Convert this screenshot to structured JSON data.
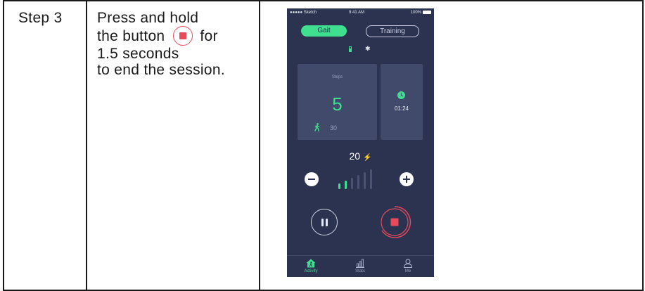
{
  "step": {
    "label": "Step 3",
    "instruction": {
      "line1": "Press and hold",
      "line2_before": "the button",
      "line2_after": "for",
      "line3": "1.5 seconds",
      "line4": "to end the session."
    },
    "inline_icon": "stop-button-icon"
  },
  "phone": {
    "status_bar": {
      "carrier": "●●●●● Sketch",
      "time": "9:41 AM",
      "battery": "100%"
    },
    "tabs": {
      "gait": "Gait",
      "training": "Training",
      "active": "Gait"
    },
    "steps_card": {
      "title": "Steps",
      "value": "5",
      "sub_value": "30",
      "icon": "walking-icon"
    },
    "timer_card": {
      "time": "01:24",
      "icon": "clock-icon"
    },
    "level": {
      "value": "20",
      "icon": "lightning-icon"
    },
    "intensity": {
      "active_bars": 2,
      "total_bars": 6
    },
    "controls": {
      "minus_icon": "minus-icon",
      "plus_icon": "plus-icon",
      "pause_icon": "pause-icon",
      "stop_icon": "stop-icon"
    },
    "tabbar": [
      {
        "label": "Activity",
        "icon": "activity-icon",
        "active": true
      },
      {
        "label": "Stats",
        "icon": "stats-icon",
        "active": false
      },
      {
        "label": "Me",
        "icon": "user-icon",
        "active": false
      }
    ]
  },
  "colors": {
    "accent": "#3ee08f",
    "phone_bg": "#2c3350",
    "card_bg": "#414a6a",
    "stop_red": "#e84a5a"
  }
}
